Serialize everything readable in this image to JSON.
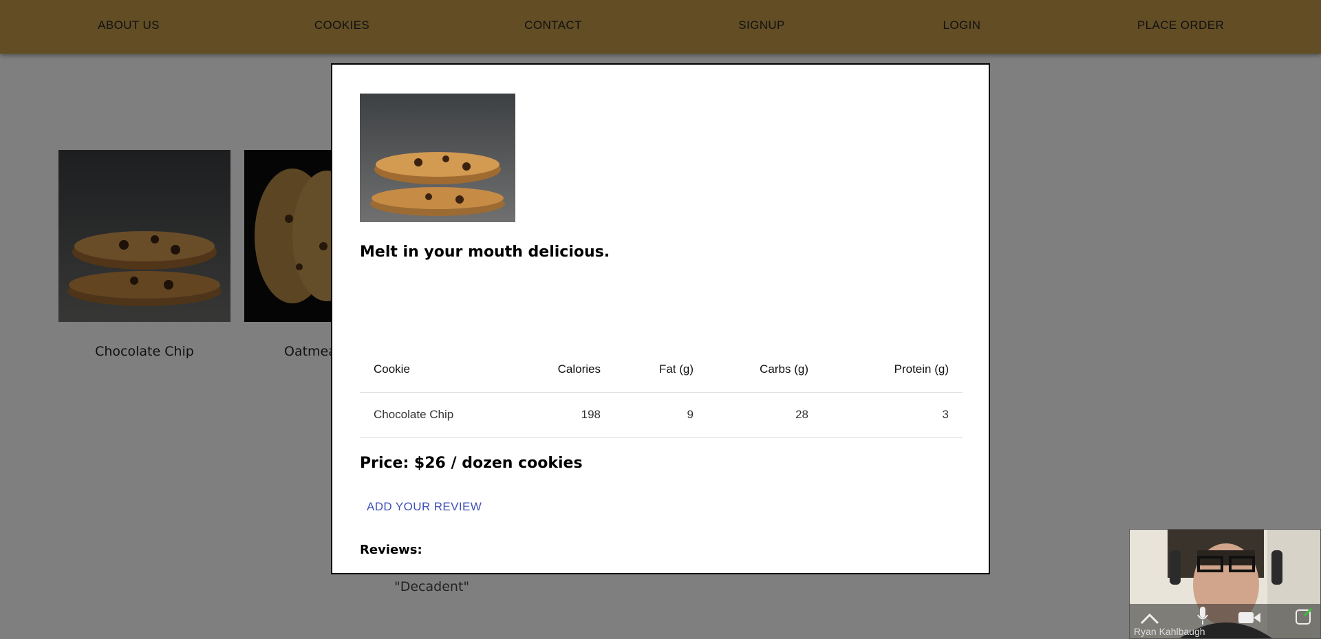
{
  "nav": {
    "items": [
      "ABOUT US",
      "COOKIES",
      "CONTACT",
      "SIGNUP",
      "LOGIN",
      "PLACE ORDER"
    ]
  },
  "cookies": [
    {
      "name": "Chocolate Chip"
    },
    {
      "name": "Oatmea"
    }
  ],
  "modal": {
    "tagline": "Melt in your mouth delicious.",
    "table": {
      "headers": [
        "Cookie",
        "Calories",
        "Fat (g)",
        "Carbs (g)",
        "Protein (g)"
      ],
      "rows": [
        [
          "Chocolate Chip",
          "198",
          "9",
          "28",
          "3"
        ]
      ]
    },
    "price": "Price: $26 / dozen cookies",
    "add_review_label": "ADD YOUR REVIEW",
    "reviews_heading": "Reviews:",
    "reviews": [
      "\"Decadent\""
    ]
  },
  "video": {
    "participant": "Ryan Kahlbaugh"
  },
  "colors": {
    "navbar": "#c49a4a",
    "link": "#3f51b5",
    "overlay": "rgba(0,0,0,0.5)"
  }
}
